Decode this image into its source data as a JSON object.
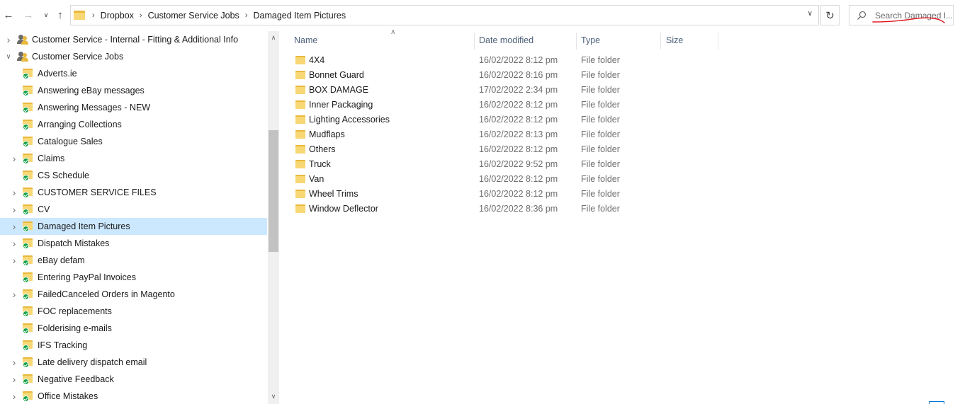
{
  "nav": {
    "back_icon": "arrow-left-icon",
    "forward_icon": "arrow-right-icon",
    "recent_icon": "chevron-down-icon",
    "up_icon": "arrow-up-icon"
  },
  "address": {
    "breadcrumbs": [
      "Dropbox",
      "Customer Service Jobs",
      "Damaged Item Pictures"
    ],
    "separator": "›"
  },
  "search": {
    "placeholder": "Search Damaged I..."
  },
  "tree": {
    "items": [
      {
        "label": "Customer Service - Internal - Fitting & Additional Info",
        "level": 0,
        "icon": "shared-folder-icon",
        "expander": "collapsed"
      },
      {
        "label": "Customer Service Jobs",
        "level": 0,
        "icon": "shared-folder-icon",
        "expander": "expanded"
      },
      {
        "label": "Adverts.ie",
        "level": 1,
        "icon": "synced-folder-icon",
        "expander": "none"
      },
      {
        "label": "Answering eBay messages",
        "level": 1,
        "icon": "synced-folder-icon",
        "expander": "none"
      },
      {
        "label": "Answering Messages - NEW",
        "level": 1,
        "icon": "synced-folder-icon",
        "expander": "none"
      },
      {
        "label": "Arranging Collections",
        "level": 1,
        "icon": "synced-folder-icon",
        "expander": "none"
      },
      {
        "label": "Catalogue Sales",
        "level": 1,
        "icon": "synced-folder-icon",
        "expander": "none"
      },
      {
        "label": "Claims",
        "level": 1,
        "icon": "synced-folder-icon",
        "expander": "collapsed"
      },
      {
        "label": "CS Schedule",
        "level": 1,
        "icon": "synced-folder-icon",
        "expander": "none"
      },
      {
        "label": "CUSTOMER SERVICE FILES",
        "level": 1,
        "icon": "synced-folder-icon",
        "expander": "collapsed"
      },
      {
        "label": "CV",
        "level": 1,
        "icon": "synced-folder-icon",
        "expander": "collapsed"
      },
      {
        "label": "Damaged Item Pictures",
        "level": 1,
        "icon": "synced-folder-icon",
        "expander": "collapsed",
        "selected": true
      },
      {
        "label": "Dispatch Mistakes",
        "level": 1,
        "icon": "synced-folder-icon",
        "expander": "collapsed"
      },
      {
        "label": "eBay defam",
        "level": 1,
        "icon": "synced-folder-icon",
        "expander": "collapsed"
      },
      {
        "label": "Entering PayPal Invoices",
        "level": 1,
        "icon": "synced-folder-icon",
        "expander": "none"
      },
      {
        "label": "FailedCanceled Orders in Magento",
        "level": 1,
        "icon": "synced-folder-icon",
        "expander": "collapsed"
      },
      {
        "label": "FOC replacements",
        "level": 1,
        "icon": "synced-folder-icon",
        "expander": "none"
      },
      {
        "label": "Folderising e-mails",
        "level": 1,
        "icon": "synced-folder-icon",
        "expander": "none"
      },
      {
        "label": "IFS Tracking",
        "level": 1,
        "icon": "synced-folder-icon",
        "expander": "none"
      },
      {
        "label": "Late delivery dispatch email",
        "level": 1,
        "icon": "synced-folder-icon",
        "expander": "collapsed"
      },
      {
        "label": "Negative Feedback",
        "level": 1,
        "icon": "synced-folder-icon",
        "expander": "collapsed"
      },
      {
        "label": "Office Mistakes",
        "level": 1,
        "icon": "synced-folder-icon",
        "expander": "collapsed"
      }
    ]
  },
  "columns": {
    "name": "Name",
    "date": "Date modified",
    "type": "Type",
    "size": "Size"
  },
  "files": [
    {
      "name": "4X4",
      "date": "16/02/2022 8:12 pm",
      "type": "File folder"
    },
    {
      "name": "Bonnet Guard",
      "date": "16/02/2022 8:16 pm",
      "type": "File folder"
    },
    {
      "name": "BOX DAMAGE",
      "date": "17/02/2022 2:34 pm",
      "type": "File folder"
    },
    {
      "name": "Inner Packaging",
      "date": "16/02/2022 8:12 pm",
      "type": "File folder"
    },
    {
      "name": "Lighting Accessories",
      "date": "16/02/2022 8:12 pm",
      "type": "File folder"
    },
    {
      "name": "Mudflaps",
      "date": "16/02/2022 8:13 pm",
      "type": "File folder"
    },
    {
      "name": "Others",
      "date": "16/02/2022 8:12 pm",
      "type": "File folder"
    },
    {
      "name": "Truck",
      "date": "16/02/2022 9:52 pm",
      "type": "File folder"
    },
    {
      "name": "Van",
      "date": "16/02/2022 8:12 pm",
      "type": "File folder"
    },
    {
      "name": "Wheel Trims",
      "date": "16/02/2022 8:12 pm",
      "type": "File folder"
    },
    {
      "name": "Window Deflector",
      "date": "16/02/2022 8:36 pm",
      "type": "File folder"
    }
  ],
  "colors": {
    "selection": "#cce8ff",
    "folder": "#f8d775",
    "sync_check": "#16a34a",
    "annotation": "#e0141e"
  }
}
